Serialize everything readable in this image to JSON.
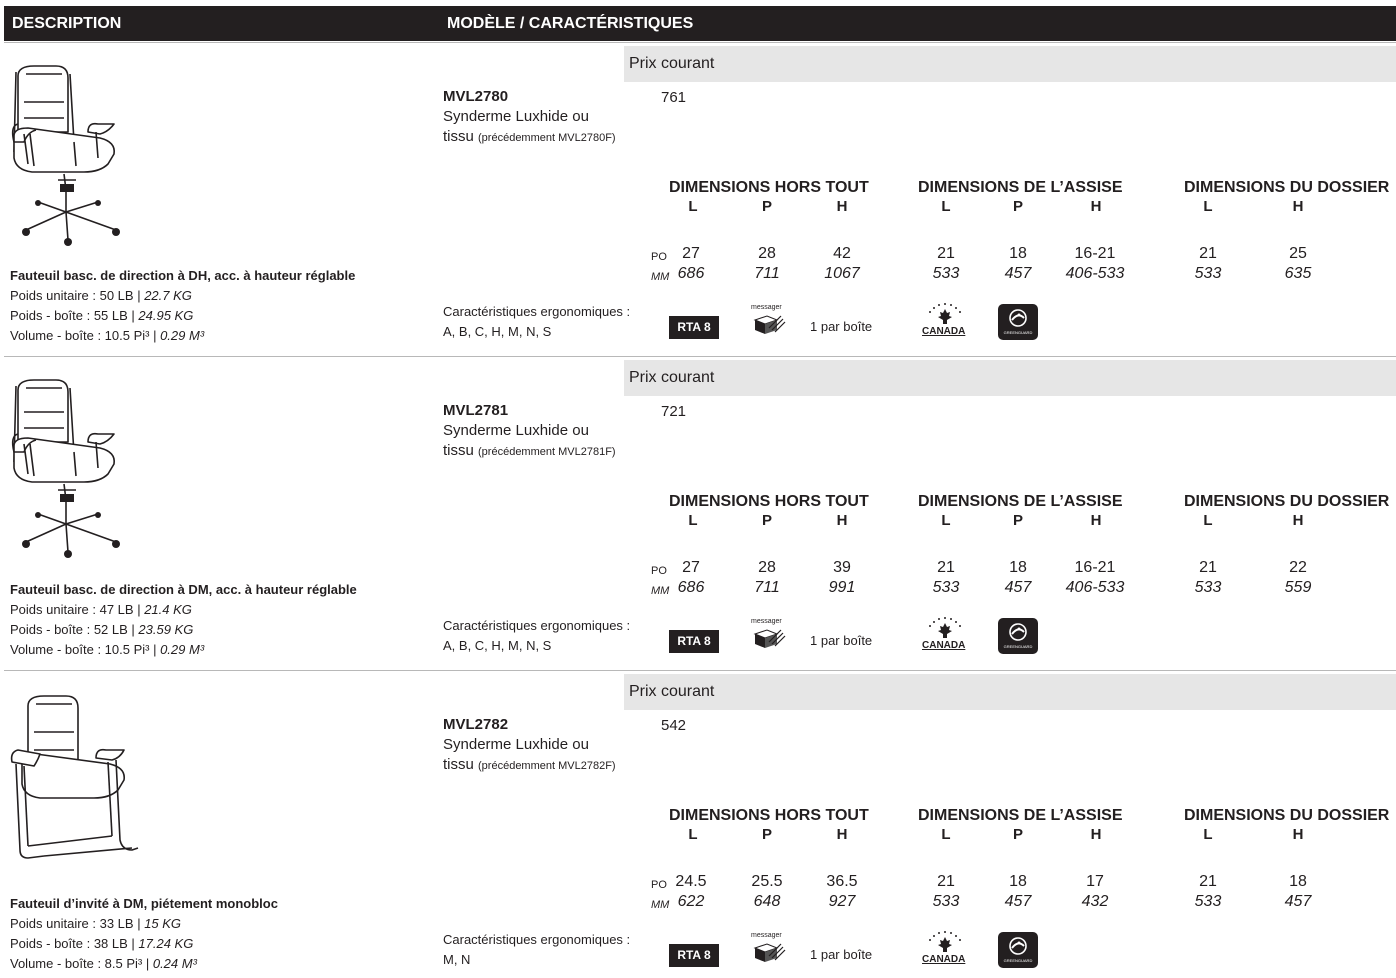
{
  "header": {
    "description_label": "DESCRIPTION",
    "model_label": "MODÈLE / CARACTÉRISTIQUES"
  },
  "common": {
    "price_label": "Prix courant",
    "dim_overall": "DIMENSIONS HORS TOUT",
    "dim_seat": "DIMENSIONS DE L’ASSISE",
    "dim_back": "DIMENSIONS DU DOSSIER",
    "col_l": "L",
    "col_p": "P",
    "col_h": "H",
    "unit_po": "PO",
    "unit_mm": "MM",
    "ergo_label": "Caractéristiques ergonomiques :",
    "rta": "RTA 8",
    "messager": "messager",
    "per_box": "1 par boîte",
    "canada": "CANADA",
    "greenguard": "GREENGUARD"
  },
  "products": [
    {
      "name": "Fauteuil basc. de direction à DH, acc. à hauteur réglable",
      "unit_weight_label": "Poids unitaire : 50 LB | ",
      "unit_weight_kg": "22.7 KG",
      "box_weight_label": "Poids - boîte : 55 LB | ",
      "box_weight_kg": "24.95 KG",
      "volume_label": "Volume - boîte : 10.5 Pi³ | ",
      "volume_m3": "0.29 M³",
      "model": "MVL2780",
      "desc1": "Synderme Luxhide ou",
      "desc2": "tissu ",
      "desc2_small": "(précédemment MVL2780F)",
      "price": "761",
      "po": [
        "27",
        "28",
        "42",
        "21",
        "18",
        "16-21",
        "21",
        "25"
      ],
      "mm": [
        "686",
        "711",
        "1067",
        "533",
        "457",
        "406-533",
        "533",
        "635"
      ],
      "ergo": "A, B, C, H, M, N, S",
      "chair_type": "high-back-chair"
    },
    {
      "name": "Fauteuil basc. de direction à DM, acc. à hauteur réglable",
      "unit_weight_label": "Poids unitaire : 47 LB | ",
      "unit_weight_kg": "21.4 KG",
      "box_weight_label": "Poids - boîte : 52 LB | ",
      "box_weight_kg": "23.59 KG",
      "volume_label": "Volume - boîte : 10.5 Pi³ | ",
      "volume_m3": "0.29 M³",
      "model": "MVL2781",
      "desc1": "Synderme Luxhide ou",
      "desc2": "tissu ",
      "desc2_small": "(précédemment MVL2781F)",
      "price": "721",
      "po": [
        "27",
        "28",
        "39",
        "21",
        "18",
        "16-21",
        "21",
        "22"
      ],
      "mm": [
        "686",
        "711",
        "991",
        "533",
        "457",
        "406-533",
        "533",
        "559"
      ],
      "ergo": "A, B, C, H, M, N, S",
      "chair_type": "mid-back-chair"
    },
    {
      "name": "Fauteuil d’invité à DM, piétement monobloc",
      "unit_weight_label": "Poids unitaire : 33 LB | ",
      "unit_weight_kg": "15 KG",
      "box_weight_label": "Poids - boîte : 38 LB | ",
      "box_weight_kg": "17.24 KG",
      "volume_label": "Volume - boîte : 8.5 Pi³ | ",
      "volume_m3": "0.24 M³",
      "model": "MVL2782",
      "desc1": "Synderme Luxhide ou",
      "desc2": "tissu ",
      "desc2_small": "(précédemment MVL2782F)",
      "price": "542",
      "po": [
        "24.5",
        "25.5",
        "36.5",
        "21",
        "18",
        "17",
        "21",
        "18"
      ],
      "mm": [
        "622",
        "648",
        "927",
        "533",
        "457",
        "432",
        "533",
        "457"
      ],
      "ergo": "M, N",
      "chair_type": "guest-chair"
    }
  ]
}
